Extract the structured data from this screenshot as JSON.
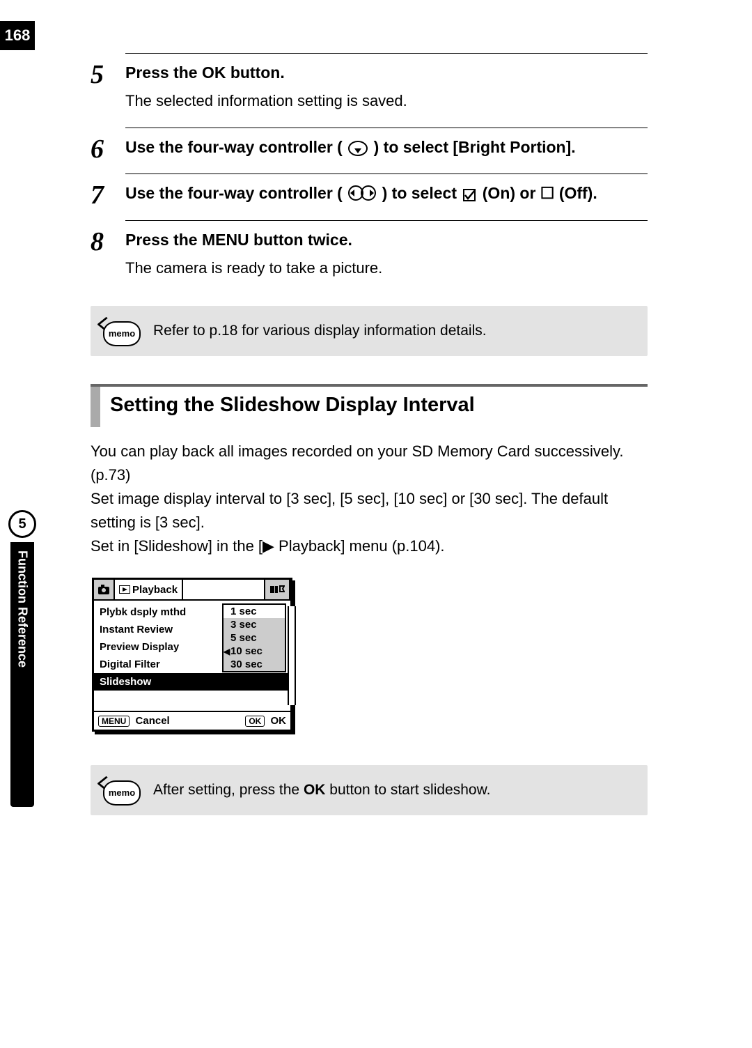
{
  "page_number": "168",
  "side": {
    "chapter_number": "5",
    "chapter_title": "Function Reference"
  },
  "steps": [
    {
      "num": "5",
      "title_plain": "Press the OK button.",
      "desc": "The selected information setting is saved."
    },
    {
      "num": "6",
      "title_before": "Use the four-way controller (",
      "title_after": ") to select [Bright Portion].",
      "icon_name": "down"
    },
    {
      "num": "7",
      "title_before": "Use the four-way controller (",
      "title_mid": ") to select ",
      "title_after": " (On) or ☐ (Off).",
      "icon_name": "leftright",
      "icon2_name": "checkbox"
    },
    {
      "num": "8",
      "title_plain": "Press the MENU button twice.",
      "desc": "The camera is ready to take a picture."
    }
  ],
  "memo1_text": "Refer to p.18 for various display information details.",
  "memo_icon_label": "memo",
  "section_heading": "Setting the Slideshow Display Interval",
  "intro_lines": [
    "You can play back all images recorded on your SD Memory Card successively. (p.73)",
    "Set image display interval to [3 sec], [5 sec], [10 sec] or [30 sec]. The default setting is [3 sec].",
    "Set in [Slideshow] in the [▶ Playback] menu (p.104)."
  ],
  "camera_menu": {
    "tab_selected": "Playback",
    "items": [
      {
        "label": "Plybk dsply mthd"
      },
      {
        "label": "Instant Review",
        "value": "1 sec"
      },
      {
        "label": "Preview Display",
        "value": "3 sec"
      },
      {
        "label": "Digital Filter",
        "value": "5 sec"
      },
      {
        "label": "Slideshow",
        "value": "10 sec",
        "selected": true
      },
      {
        "label": "",
        "value": "30 sec"
      }
    ],
    "options": [
      "1 sec",
      "3 sec",
      "5 sec",
      "10 sec",
      "30 sec"
    ],
    "footer": {
      "left_key": "MENU",
      "left_label": "Cancel",
      "right_key": "OK",
      "right_label": "OK"
    }
  },
  "memo2_before": "After setting, press the ",
  "memo2_ok": "OK",
  "memo2_after": " button to start slideshow."
}
